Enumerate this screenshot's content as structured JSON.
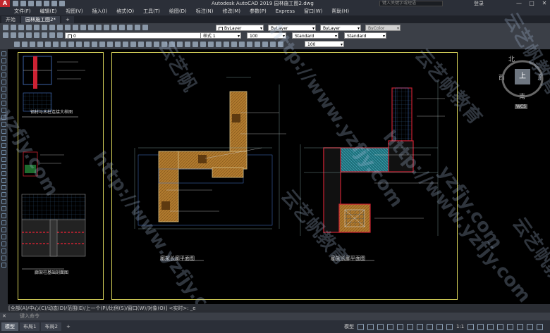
{
  "app": {
    "logo": "A",
    "title": "Autodesk AutoCAD 2019    园林施工图2.dwg",
    "search_placeholder": "键入关键字或短语",
    "login": "登录",
    "window_controls": [
      "—",
      "□",
      "✕"
    ]
  },
  "menu": [
    "文件(F)",
    "编辑(E)",
    "视图(V)",
    "插入(I)",
    "格式(O)",
    "工具(T)",
    "绘图(D)",
    "标注(N)",
    "修改(M)",
    "参数(P)",
    "Express",
    "窗口(W)",
    "帮助(H)"
  ],
  "tabs": [
    {
      "label": "开始",
      "active": false
    },
    {
      "label": "园林施工图2*",
      "active": true
    },
    {
      "label": "+",
      "active": false
    }
  ],
  "toolbars": {
    "layer_value": "0",
    "color_value": "ByLayer",
    "linetype_value": "ByLayer",
    "lineweight_value": "ByLayer",
    "plotstyle_value": "ByColor",
    "textstyle_value": "样式 1",
    "scale_value": "100",
    "dimstyle_value": "Standard",
    "tablestyle_value": "Standard",
    "zoom_value": "100"
  },
  "viewcube": {
    "north": "北",
    "south": "南",
    "east": "东",
    "west": "西",
    "face": "上",
    "wcs": "WCS"
  },
  "drawing": {
    "title_left_plan": "廊架长廊平面图",
    "title_right_plan": "廊架长廊平面图",
    "title_left_detail": "钢材与木柱连接大样图",
    "title_left_bottom": "廊架柱基础剖面图"
  },
  "command": {
    "history": "[全部(A)/中心(C)/动态(D)/范围(E)/上一个(P)/比例(S)/窗口(W)/对象(O)] <实时>: _e",
    "close": "✕",
    "placeholder": "键入命令"
  },
  "status": {
    "layout_tabs": [
      {
        "label": "模型",
        "active": true
      },
      {
        "label": "布局1",
        "active": false
      },
      {
        "label": "布局2",
        "active": false
      },
      {
        "label": "+",
        "active": false
      }
    ],
    "model_label": "模型",
    "scale": "1:1"
  },
  "watermarks": [
    "yzfjy.com",
    "http://www.yzfjy.com",
    "云艺帆教育",
    "云艺帆教育",
    "http://www.yzfjy.com",
    "云艺帆",
    "yzfjy.com",
    "云艺帆教育",
    "http://www.yzfjy.com",
    "云艺帆教育"
  ]
}
